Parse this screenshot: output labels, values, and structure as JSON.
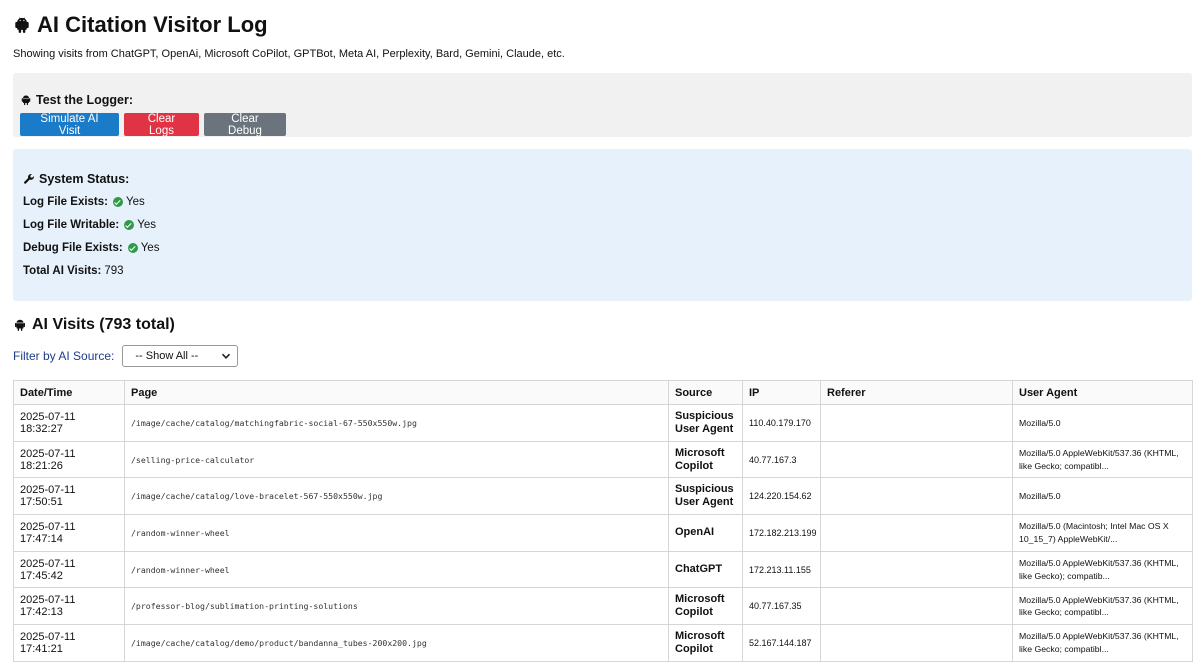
{
  "header": {
    "title": "AI Citation Visitor Log",
    "subtitle": "Showing visits from ChatGPT, OpenAi, Microsoft CoPilot, GPTBot, Meta AI, Perplexity, Bard, Gemini, Claude, etc."
  },
  "test": {
    "title": "Test the Logger:",
    "simulate_label": "Simulate AI Visit",
    "clear_logs_label": "Clear Logs",
    "clear_debug_label": "Clear Debug"
  },
  "status": {
    "title": "System Status:",
    "log_exists_label": "Log File Exists:",
    "log_exists_value": "Yes",
    "log_writable_label": "Log File Writable:",
    "log_writable_value": "Yes",
    "debug_exists_label": "Debug File Exists:",
    "debug_exists_value": "Yes",
    "total_label": "Total AI Visits:",
    "total_value": "793"
  },
  "visits": {
    "title": "AI Visits (793 total)",
    "filter_label": "Filter by AI Source:",
    "filter_selected": "-- Show All --"
  },
  "table": {
    "headers": [
      "Date/Time",
      "Page",
      "Source",
      "IP",
      "Referer",
      "User Agent"
    ],
    "rows": [
      {
        "datetime": "2025-07-11 18:32:27",
        "page": "/image/cache/catalog/matchingfabric-social-67-550x550w.jpg",
        "source": "Suspicious User Agent",
        "ip": "110.40.179.170",
        "referer": "",
        "ua": "Mozilla/5.0"
      },
      {
        "datetime": "2025-07-11 18:21:26",
        "page": "/selling-price-calculator",
        "source": "Microsoft Copilot",
        "ip": "40.77.167.3",
        "referer": "",
        "ua": "Mozilla/5.0 AppleWebKit/537.36 (KHTML, like Gecko; compatibl..."
      },
      {
        "datetime": "2025-07-11 17:50:51",
        "page": "/image/cache/catalog/love-bracelet-567-550x550w.jpg",
        "source": "Suspicious User Agent",
        "ip": "124.220.154.62",
        "referer": "",
        "ua": "Mozilla/5.0"
      },
      {
        "datetime": "2025-07-11 17:47:14",
        "page": "/random-winner-wheel",
        "source": "OpenAI",
        "ip": "172.182.213.199",
        "referer": "",
        "ua": "Mozilla/5.0 (Macintosh; Intel Mac OS X 10_15_7) AppleWebKit/..."
      },
      {
        "datetime": "2025-07-11 17:45:42",
        "page": "/random-winner-wheel",
        "source": "ChatGPT",
        "ip": "172.213.11.155",
        "referer": "",
        "ua": "Mozilla/5.0 AppleWebKit/537.36 (KHTML, like Gecko); compatib..."
      },
      {
        "datetime": "2025-07-11 17:42:13",
        "page": "/professor-blog/sublimation-printing-solutions",
        "source": "Microsoft Copilot",
        "ip": "40.77.167.35",
        "referer": "",
        "ua": "Mozilla/5.0 AppleWebKit/537.36 (KHTML, like Gecko; compatibl..."
      },
      {
        "datetime": "2025-07-11 17:41:21",
        "page": "/image/cache/catalog/demo/product/bandanna_tubes-200x200.jpg",
        "source": "Microsoft Copilot",
        "ip": "52.167.144.187",
        "referer": "",
        "ua": "Mozilla/5.0 AppleWebKit/537.36 (KHTML, like Gecko; compatibl..."
      }
    ]
  }
}
